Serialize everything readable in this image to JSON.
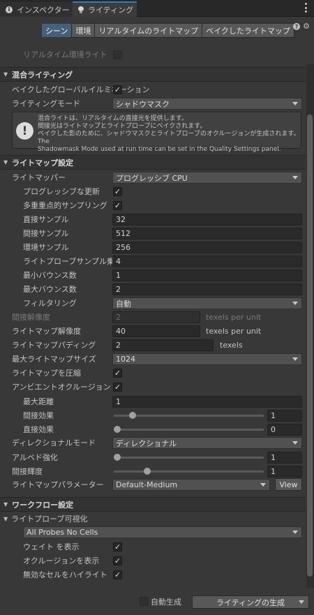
{
  "tabs": [
    {
      "label": "インスペクター",
      "icon": "info-icon",
      "active": false
    },
    {
      "label": "ライティング",
      "icon": "bulb-icon",
      "active": true
    }
  ],
  "subtabs": [
    "シーン",
    "環境",
    "リアルタイムのライトマップ",
    "ベイクしたライトマップ"
  ],
  "realtime_env_light": "リアルタイム環境ライト",
  "mixed": {
    "header": "混合ライティング",
    "baked_gi_label": "ベイクしたグローバルイルミネーション",
    "baked_gi_checked": true,
    "mode_label": "ライティングモード",
    "mode_value": "シャドウマスク",
    "info_lines": [
      "混合ライトは、リアルタイムの直接光を提供します。",
      "間接光はライトマップとライトプローブにベイクされます。",
      "ベイクした影のために、シャドウマスクとライトプローブのオクルージョンが生成されます。 The",
      "Shadowmask Mode used at run time can be set in the Quality Settings panel."
    ]
  },
  "lightmap": {
    "header": "ライトマップ設定",
    "lightmapper_label": "ライトマッパー",
    "lightmapper_value": "プログレッシブ CPU",
    "progressive_update_label": "プログレッシブな更新",
    "mis_label": "多重重点的サンプリング",
    "direct_samples_label": "直接サンプル",
    "direct_samples": "32",
    "indirect_samples_label": "間接サンプル",
    "indirect_samples": "512",
    "env_samples_label": "環境サンプル",
    "env_samples": "256",
    "probe_mult_label": "ライトプローブサンプル乗数",
    "probe_mult": "4",
    "min_bounces_label": "最小バウンス数",
    "min_bounces": "1",
    "max_bounces_label": "最大バウンス数",
    "max_bounces": "2",
    "filtering_label": "フィルタリング",
    "filtering_value": "自動",
    "indirect_res_label": "間接解像度",
    "indirect_res": "2",
    "texels_per_unit": "texels per unit",
    "lm_res_label": "ライトマップ解像度",
    "lm_res": "40",
    "padding_label": "ライトマップパディング",
    "padding": "2",
    "texels": "texels",
    "max_size_label": "最大ライトマップサイズ",
    "max_size": "1024",
    "compress_label": "ライトマップを圧縮",
    "ao_label": "アンビエントオクルージョン",
    "max_dist_label": "最大距離",
    "max_dist": "1",
    "ind_contrib_label": "間接効果",
    "ind_contrib": "1",
    "ind_contrib_level": 0.1,
    "dir_contrib_label": "直接効果",
    "dir_contrib": "0",
    "dir_contrib_level": 0.0,
    "directional_label": "ディレクショナルモード",
    "directional_value": "ディレクショナル",
    "albedo_label": "アルベド強化",
    "albedo": "1",
    "albedo_level": 0.0,
    "indirect_intensity_label": "間接輝度",
    "indirect_intensity": "1",
    "indirect_intensity_level": 0.2,
    "params_label": "ライトマップパラメーター",
    "params_value": "Default-Medium",
    "view_label": "View"
  },
  "workflow": {
    "header": "ワークフロー設定",
    "probe_vis_label": "ライトプローブ可視化",
    "probe_vis_value": "All Probes No Cells",
    "show_weights_label": "ウェイト を表示",
    "show_occlusion_label": "オクルージョンを表示",
    "highlight_invalid_label": "無効なセルをハイライト"
  },
  "footer": {
    "auto_generate_label": "自動生成",
    "auto_generate_checked": false,
    "generate_label": "ライティングの生成"
  },
  "colors": {
    "accent": "#3a79bb",
    "selected_tab": "#46607c",
    "background": "#383838"
  }
}
